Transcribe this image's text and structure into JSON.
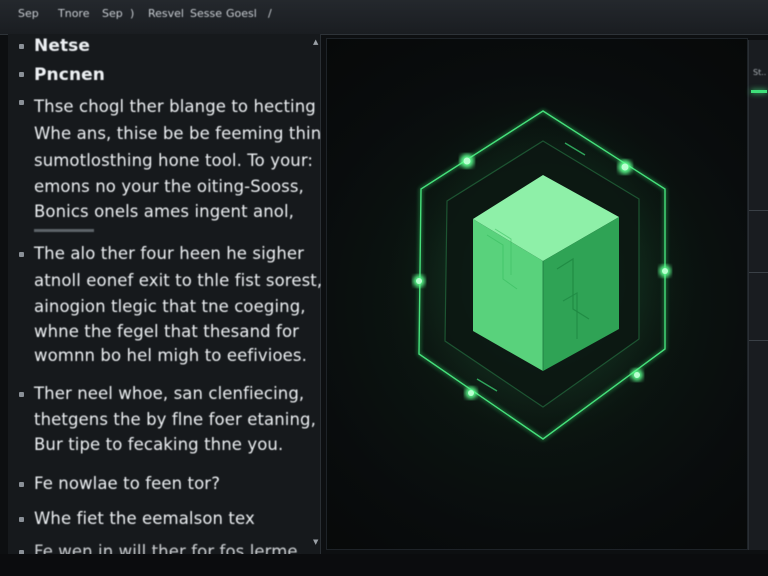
{
  "menubar": {
    "items": [
      "Sep",
      "Tnore",
      "Sep",
      ")",
      "Resvel",
      "Sesse",
      "Goesl",
      "/"
    ],
    "colors": {
      "background": "#1f2327",
      "text": "#c9ced3"
    }
  },
  "left_panel": {
    "heading1": "Netse",
    "heading2": "Pncnen",
    "paragraph1": [
      "Thse chogl ther blange to hecting",
      "Whe ans, thise be be feeming thin",
      "sumotlosthing hone tool. To your:",
      "emons no your the oiting-Sooss,",
      "Bonics onels ames ingent anol,"
    ],
    "paragraph2": [
      "The alo ther four heen he sigher",
      "atnoll eonef exit to thle fist sorest,",
      "ainogion tlegic that tne coeging,",
      "whne the fegel that thesand for",
      "womnn bo hel migh to eefivioes."
    ],
    "paragraph3": [
      "Ther neel whoe, san clenfiecing,",
      "thetgens the by flne foer etaning,",
      "Bur tipe to fecaking thne you."
    ],
    "line4": "Fe nowlae to feen tor?",
    "line5": "Whe fiet the eemalson tex",
    "line6": "Fe wen in will ther for fos lerme.",
    "colors": {
      "background": "#16191c",
      "text": "#eef1f4"
    }
  },
  "canvas": {
    "graphic_icon": "glowing-cube-hexagon-icon",
    "colors": {
      "accent": "#3fe07a",
      "cube_top": "#8ef0a8",
      "cube_left": "#5ad37d",
      "cube_right": "#2fa355",
      "background": "#090c0d"
    }
  },
  "right_strip": {
    "label": "St.."
  }
}
